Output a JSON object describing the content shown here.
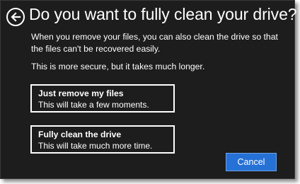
{
  "header": {
    "back_icon": "back-arrow-icon",
    "title": "Do you want to fully clean your drive?"
  },
  "body": {
    "description": "When you remove your files, you can also clean the drive so that the files can't be recovered easily.",
    "note": "This is more secure, but it takes much longer."
  },
  "options": [
    {
      "title": "Just remove my files",
      "subtitle": "This will take a few moments."
    },
    {
      "title": "Fully clean the drive",
      "subtitle": "This will take much more time."
    }
  ],
  "footer": {
    "cancel_label": "Cancel"
  },
  "colors": {
    "background": "#1d1d1d",
    "accent": "#2571d6",
    "text": "#ffffff"
  }
}
